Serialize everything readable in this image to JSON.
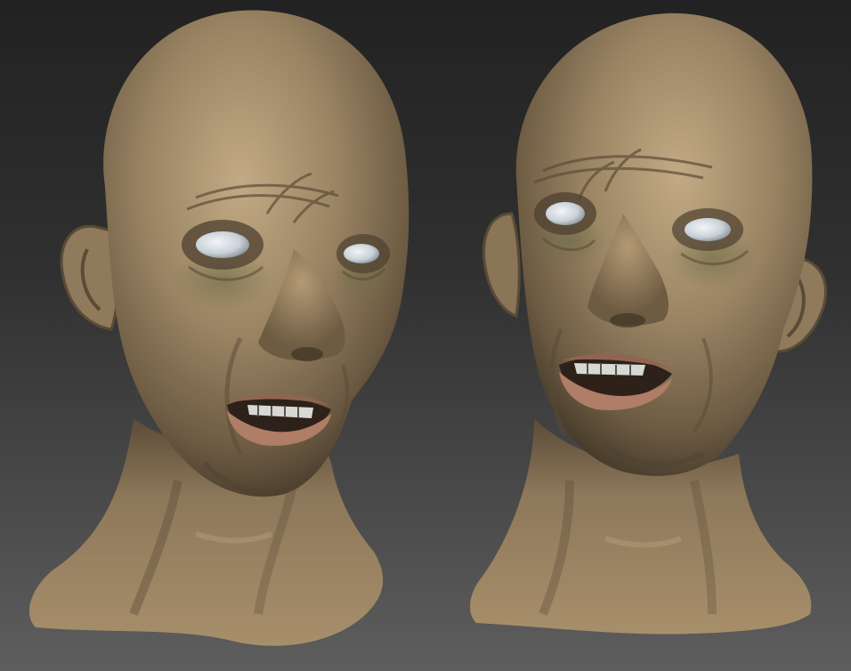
{
  "viewport": {
    "background_top": "#222222",
    "background_bottom": "#5e5e5e"
  },
  "render": {
    "skin_color": "#9a8566",
    "skin_shadow": "#4f4331",
    "skin_highlight": "#c4ad89",
    "lip_color": "#b07d66",
    "eye_color": "#d6dde4",
    "bruise_color": "#6f7048"
  },
  "models": [
    {
      "name": "head-three-quarter-left"
    },
    {
      "name": "head-three-quarter-right"
    }
  ]
}
